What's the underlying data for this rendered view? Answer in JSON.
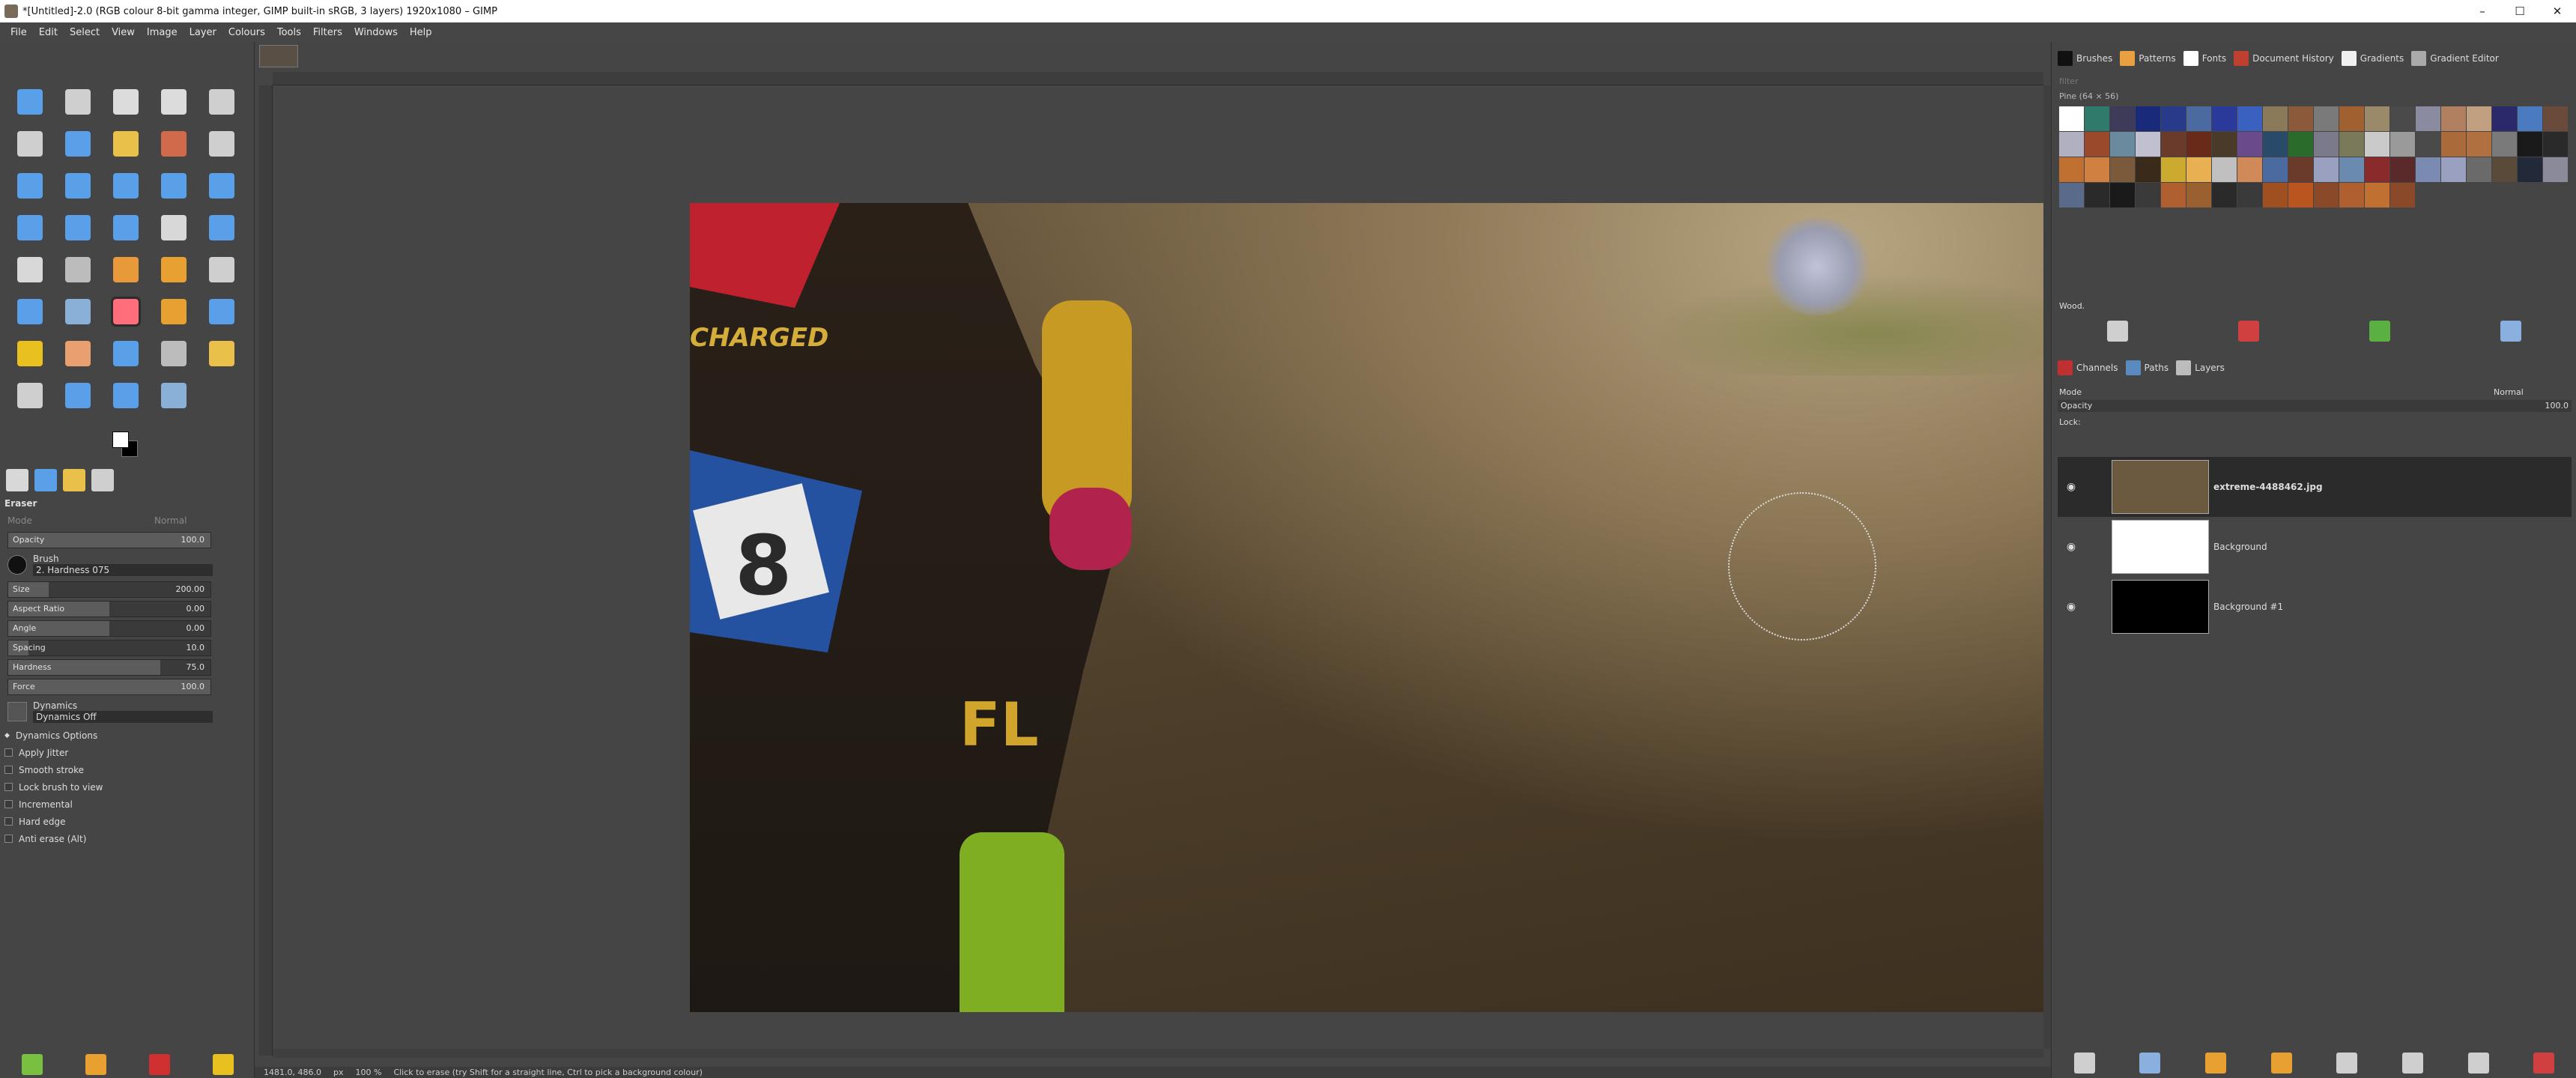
{
  "window": {
    "title": "*[Untitled]-2.0 (RGB colour 8-bit gamma integer, GIMP built-in sRGB, 3 layers) 1920x1080 – GIMP",
    "controls": [
      "–",
      "☐",
      "✕"
    ]
  },
  "menu": [
    "File",
    "Edit",
    "Select",
    "View",
    "Image",
    "Layer",
    "Colours",
    "Tools",
    "Filters",
    "Windows",
    "Help"
  ],
  "tools": [
    {
      "name": "move-icon",
      "color": "#5aa0e8"
    },
    {
      "name": "align-icon",
      "color": "#cfcfcf"
    },
    {
      "name": "rect-select-icon",
      "color": "#dcdcdc"
    },
    {
      "name": "ellipse-select-icon",
      "color": "#dcdcdc"
    },
    {
      "name": "free-select-icon",
      "color": "#cfcfcf"
    },
    {
      "name": "scissors-icon",
      "color": "#cfcfcf"
    },
    {
      "name": "foreground-select-icon",
      "color": "#5aa0e8"
    },
    {
      "name": "fuzzy-select-icon",
      "color": "#e8c04a"
    },
    {
      "name": "color-select-icon",
      "color": "#d06a4a"
    },
    {
      "name": "paths-icon",
      "color": "#cfcfcf"
    },
    {
      "name": "crop-icon",
      "color": "#5aa0e8"
    },
    {
      "name": "unified-transform-icon",
      "color": "#5aa0e8"
    },
    {
      "name": "rotate-icon",
      "color": "#5aa0e8"
    },
    {
      "name": "scale-icon",
      "color": "#5aa0e8"
    },
    {
      "name": "flip-icon",
      "color": "#5aa0e8"
    },
    {
      "name": "perspective-icon",
      "color": "#5aa0e8"
    },
    {
      "name": "cage-icon",
      "color": "#5aa0e8"
    },
    {
      "name": "warp-icon",
      "color": "#5aa0e8"
    },
    {
      "name": "handle-transform-icon",
      "color": "#d8d8d8"
    },
    {
      "name": "shear-icon",
      "color": "#5aa0e8"
    },
    {
      "name": "bucket-fill-icon",
      "color": "#d8d8d8"
    },
    {
      "name": "gradient-icon",
      "color": "#bcbcbc"
    },
    {
      "name": "paintbrush-icon",
      "color": "#e89a3a"
    },
    {
      "name": "pencil-icon",
      "color": "#e8a030"
    },
    {
      "name": "ink-icon",
      "color": "#cfcfcf"
    },
    {
      "name": "clone-icon",
      "color": "#5aa0e8"
    },
    {
      "name": "heal-icon",
      "color": "#8ab0d8"
    },
    {
      "name": "eraser-icon",
      "color": "#ff6e7a"
    },
    {
      "name": "airbrush-icon",
      "color": "#e8a030"
    },
    {
      "name": "smudge-icon",
      "color": "#5aa0e8"
    },
    {
      "name": "perspective-clone-icon",
      "color": "#e8c020"
    },
    {
      "name": "mypaint-brush-icon",
      "color": "#e8a070"
    },
    {
      "name": "blur-icon",
      "color": "#5aa0e8"
    },
    {
      "name": "dodge-icon",
      "color": "#bcbcbc"
    },
    {
      "name": "measure-icon",
      "color": "#e8c04a"
    },
    {
      "name": "text-icon",
      "color": "#cfcfcf"
    },
    {
      "name": "color-picker-icon",
      "color": "#5aa0e8"
    },
    {
      "name": "ink-pen-icon",
      "color": "#5aa0e8"
    },
    {
      "name": "zoom-icon",
      "color": "#8ab0d8"
    }
  ],
  "active_tool_index": 27,
  "tool_tabs": [
    {
      "name": "tool-options-tab-icon",
      "color": "#d8d8d8"
    },
    {
      "name": "device-status-tab-icon",
      "color": "#5aa0e8"
    },
    {
      "name": "undo-history-tab-icon",
      "color": "#e8c04a"
    },
    {
      "name": "images-tab-icon",
      "color": "#cfcfcf"
    }
  ],
  "tool_options": {
    "title": "Eraser",
    "mode_label": "Mode",
    "mode_value": "Normal",
    "opacity_label": "Opacity",
    "opacity_value": "100.0",
    "brush_label": "Brush",
    "brush_value": "2. Hardness 075",
    "sliders": [
      {
        "label": "Size",
        "value": "200.00",
        "fill": 0.2
      },
      {
        "label": "Aspect Ratio",
        "value": "0.00",
        "fill": 0.5
      },
      {
        "label": "Angle",
        "value": "0.00",
        "fill": 0.5
      },
      {
        "label": "Spacing",
        "value": "10.0",
        "fill": 0.1
      },
      {
        "label": "Hardness",
        "value": "75.0",
        "fill": 0.75
      },
      {
        "label": "Force",
        "value": "100.0",
        "fill": 1.0
      }
    ],
    "dynamics_label": "Dynamics",
    "dynamics_value": "Dynamics Off",
    "dynamics_options": "Dynamics Options",
    "checkboxes": [
      {
        "label": "Apply Jitter",
        "checked": false
      },
      {
        "label": "Smooth stroke",
        "checked": false
      },
      {
        "label": "Lock brush to view",
        "checked": false
      },
      {
        "label": "Incremental",
        "checked": false
      },
      {
        "label": "Hard edge",
        "checked": false
      },
      {
        "label": "Anti erase  (Alt)",
        "checked": false
      }
    ]
  },
  "toolbox_bottom": [
    {
      "name": "save-tool-preset-icon",
      "color": "#7ac040"
    },
    {
      "name": "restore-tool-preset-icon",
      "color": "#e8a030"
    },
    {
      "name": "delete-tool-preset-icon",
      "color": "#d03030"
    },
    {
      "name": "reset-tool-options-icon",
      "color": "#e8c020"
    }
  ],
  "canvas": {
    "image_text": {
      "charged": "CHARGED",
      "number": "8",
      "pants": "FL"
    }
  },
  "dock": {
    "top_tabs": [
      {
        "name": "brushes-tab",
        "label": "Brushes",
        "color": "#111111"
      },
      {
        "name": "patterns-tab",
        "label": "Patterns",
        "color": "#e8a040"
      },
      {
        "name": "fonts-tab",
        "label": "Fonts",
        "color": "#ffffff"
      },
      {
        "name": "document-history-tab",
        "label": "Document History",
        "color": "#c04030"
      },
      {
        "name": "gradients-tab",
        "label": "Gradients",
        "color": "#f0f0f0"
      },
      {
        "name": "gradient-editor-tab",
        "label": "Gradient Editor",
        "color": "#aaaaaa"
      }
    ],
    "filter_placeholder": "filter",
    "pattern_size": "Pine (64 × 56)",
    "patterns": [
      "#ffffff",
      "#2f7a6a",
      "#3d3a5a",
      "#1a2a7a",
      "#2a3a8a",
      "#4a6aa0",
      "#2a3a9a",
      "#3a60c0",
      "#8a7a5a",
      "#8a5a3a",
      "#7a7a7a",
      "#a06030",
      "#9a8a6a",
      "#4a4a4a",
      "#8a8aa0",
      "#b08060",
      "#c0a080",
      "#2a2a6a",
      "#4a7ac0",
      "#6a4a3a",
      "#b0b0c0",
      "#9a4a2a",
      "#6a8aa0",
      "#c0c0d0",
      "#6a3a2a",
      "#6a2a1a",
      "#4a3a2a",
      "#6a4a8a",
      "#2a4a6a",
      "#2a6a2a",
      "#7a7a8a",
      "#7a7a5a",
      "#cacaca",
      "#9a9a9a",
      "#4a4a4a",
      "#aa6a3a",
      "#b07040",
      "#7a7a7a",
      "#1a1a1a",
      "#2a2a2a",
      "#c07030",
      "#d08040",
      "#7a5a3a",
      "#3a2a1a",
      "#ccaa30",
      "#e8b050",
      "#c0c0c0",
      "#d08a5a",
      "#4a6aa0",
      "#6a3a2a",
      "#9aa0c0",
      "#6a8ab0",
      "#8a2a2a",
      "#5a2a2a",
      "#7a8ab0",
      "#9aa0c0",
      "#6a6a6a",
      "#5a4a3a",
      "#222a3a",
      "#8a8a9a",
      "#5a6a8a",
      "#2a2a2a",
      "#1a1a1a",
      "#3a3a3a",
      "#b06030",
      "#9a6030",
      "#2a2a2a",
      "#3a3a3a",
      "#a05020",
      "#bb5520",
      "#8a4a2a",
      "#b06030",
      "#c07030",
      "#8a4a2a"
    ],
    "preset_name": "Wood.",
    "pattern_buttons": [
      {
        "name": "duplicate-pattern-icon",
        "color": "#cfcfcf"
      },
      {
        "name": "delete-pattern-icon",
        "color": "#d04040"
      },
      {
        "name": "refresh-patterns-icon",
        "color": "#5ab040"
      },
      {
        "name": "open-as-image-icon",
        "color": "#8ab0e0"
      }
    ],
    "layer_tabs": [
      {
        "name": "channels-tab",
        "label": "Channels",
        "color": "#c03030"
      },
      {
        "name": "paths-tab",
        "label": "Paths",
        "color": "#5a8ac0"
      },
      {
        "name": "layers-tab",
        "label": "Layers",
        "color": "#bcbcbc"
      }
    ],
    "mode_label": "Mode",
    "mode_value": "Normal",
    "opacity_label": "Opacity",
    "opacity_value": "100.0",
    "lock_label": "Lock:",
    "layers": [
      {
        "name": "extreme-4488462.jpg",
        "thumb": "#6b5a40",
        "selected": true
      },
      {
        "name": "Background",
        "thumb": "#ffffff",
        "selected": false
      },
      {
        "name": "Background #1",
        "thumb": "#000000",
        "selected": false
      }
    ],
    "layer_buttons": [
      {
        "name": "new-layer-icon",
        "color": "#cfcfcf"
      },
      {
        "name": "new-layer-group-icon",
        "color": "#8ab0e0"
      },
      {
        "name": "raise-layer-icon",
        "color": "#e8a030"
      },
      {
        "name": "lower-layer-icon",
        "color": "#e8a030"
      },
      {
        "name": "duplicate-layer-icon",
        "color": "#cfcfcf"
      },
      {
        "name": "anchor-layer-icon",
        "color": "#cfcfcf"
      },
      {
        "name": "merge-down-icon",
        "color": "#cfcfcf"
      },
      {
        "name": "delete-layer-icon",
        "color": "#d04040"
      }
    ]
  },
  "status": {
    "coords": "1481.0, 486.0",
    "unit": "px",
    "zoom": "100 %",
    "message": "Click to erase (try Shift for a straight line, Ctrl to pick a background colour)"
  }
}
